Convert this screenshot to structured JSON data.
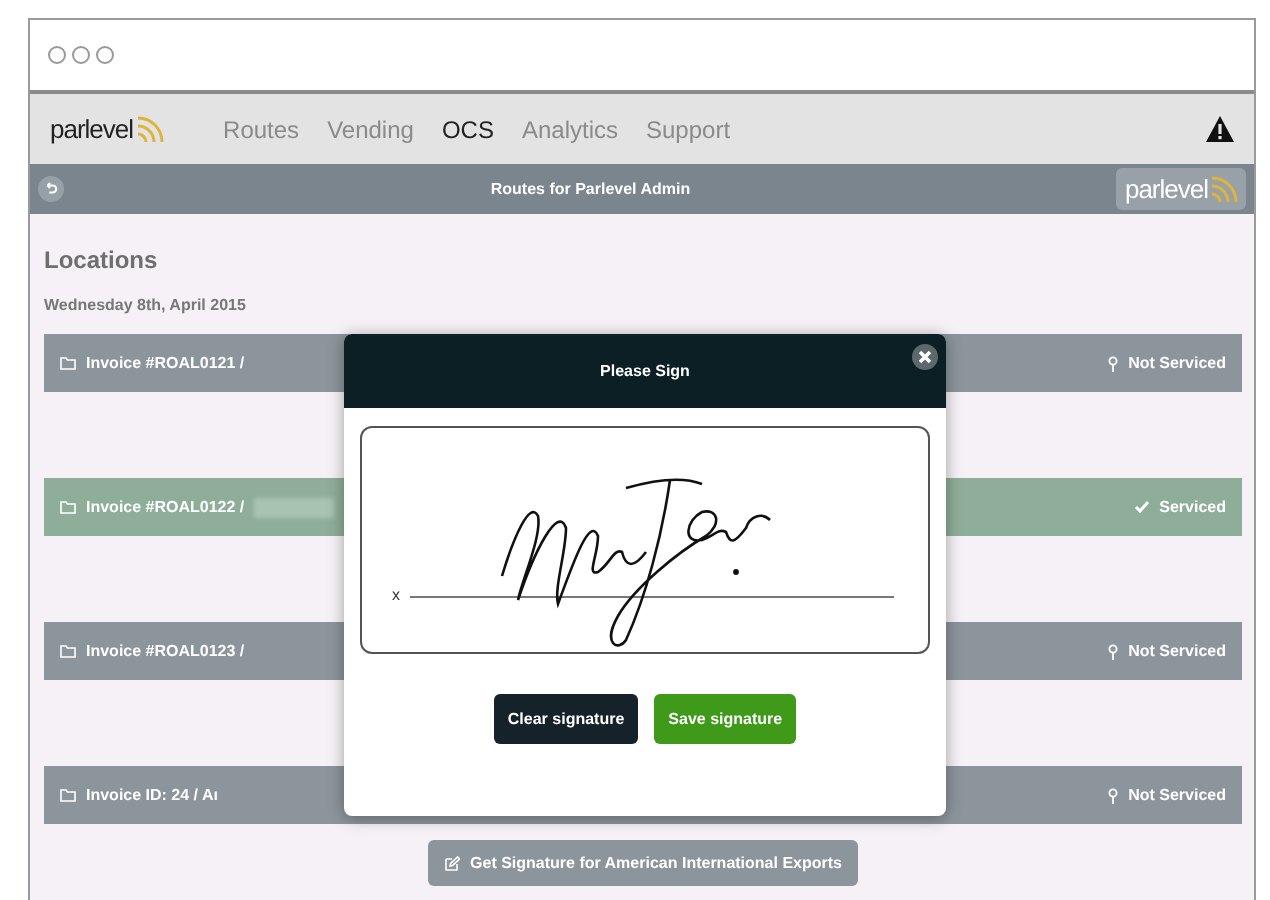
{
  "nav": {
    "logo": "parlevel",
    "items": [
      {
        "label": "Routes",
        "selected": false
      },
      {
        "label": "Vending",
        "selected": false
      },
      {
        "label": "OCS",
        "selected": true
      },
      {
        "label": "Analytics",
        "selected": false
      },
      {
        "label": "Support",
        "selected": false
      }
    ]
  },
  "header": {
    "title": "Routes for Parlevel Admin",
    "logo": "parlevel"
  },
  "locations": {
    "title": "Locations",
    "date": "Wednesday 8th, April 2015",
    "rows": [
      {
        "label": "Invoice #ROAL0121 /",
        "redacted": false,
        "serviced": false,
        "status": "Not Serviced"
      },
      {
        "label": "Invoice #ROAL0122 /",
        "redacted": true,
        "serviced": true,
        "status": "Serviced"
      },
      {
        "label": "Invoice #ROAL0123 /",
        "redacted": false,
        "serviced": false,
        "status": "Not Serviced"
      },
      {
        "label": "Invoice ID: 24 / Aı",
        "redacted": false,
        "serviced": false,
        "status": "Not Serviced"
      }
    ],
    "action": "Get Signature for American International Exports"
  },
  "modal": {
    "title": "Please Sign",
    "mark": "x",
    "buttons": [
      {
        "label": "Clear signature",
        "kind": "secondary"
      },
      {
        "label": "Save signature",
        "kind": "primary"
      }
    ]
  }
}
